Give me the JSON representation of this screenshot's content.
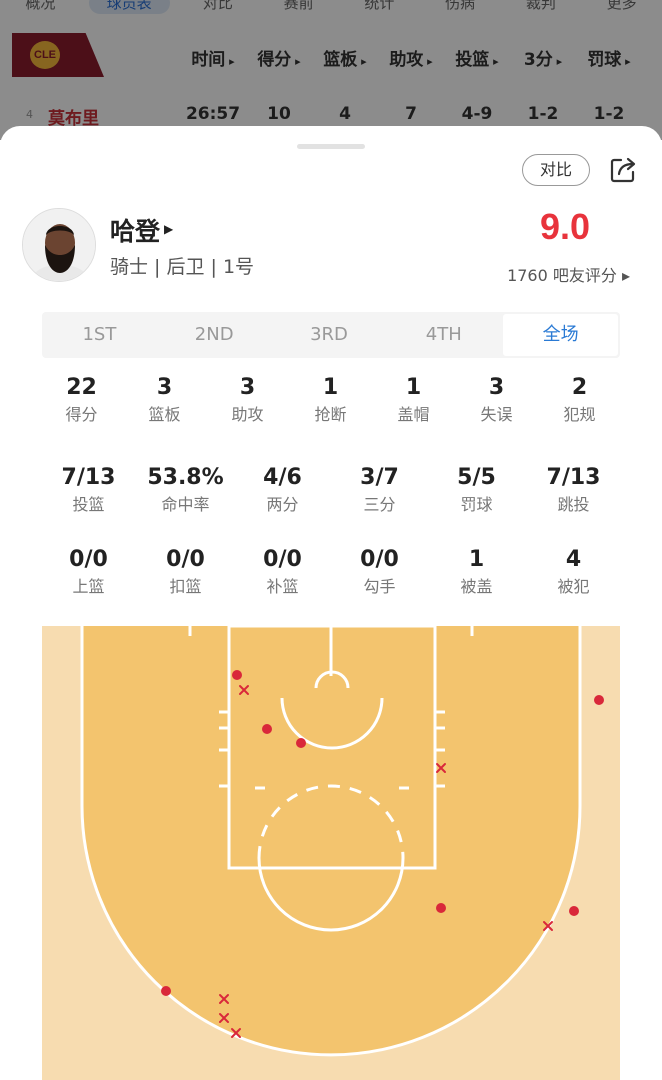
{
  "background": {
    "tabs": [
      "概况",
      "球员表",
      "对比",
      "赛前",
      "统计",
      "伤病",
      "裁判",
      "更多"
    ],
    "active_tab_index": 1,
    "team_logo_text": "CLE",
    "columns": [
      "时间",
      "得分",
      "篮板",
      "助攻",
      "投篮",
      "3分",
      "罚球"
    ],
    "row": {
      "rank": "4",
      "name": "莫布里",
      "values": [
        "26:57",
        "10",
        "4",
        "7",
        "4-9",
        "1-2",
        "1-2"
      ]
    }
  },
  "sheet": {
    "compare_label": "对比",
    "share_icon": "share-icon",
    "player": {
      "name": "哈登",
      "meta": "骑士 | 后卫 | 1号",
      "rating": "9.0",
      "rating_count": "1760 吧友评分 ▸"
    },
    "periods": [
      "1ST",
      "2ND",
      "3RD",
      "4TH",
      "全场"
    ],
    "active_period_index": 4,
    "stats_row1": [
      {
        "value": "22",
        "label": "得分"
      },
      {
        "value": "3",
        "label": "篮板"
      },
      {
        "value": "3",
        "label": "助攻"
      },
      {
        "value": "1",
        "label": "抢断"
      },
      {
        "value": "1",
        "label": "盖帽"
      },
      {
        "value": "3",
        "label": "失误"
      },
      {
        "value": "2",
        "label": "犯规"
      }
    ],
    "stats_row2": [
      {
        "value": "7/13",
        "label": "投篮"
      },
      {
        "value": "53.8%",
        "label": "命中率"
      },
      {
        "value": "4/6",
        "label": "两分"
      },
      {
        "value": "3/7",
        "label": "三分"
      },
      {
        "value": "5/5",
        "label": "罚球"
      },
      {
        "value": "7/13",
        "label": "跳投"
      }
    ],
    "stats_row3": [
      {
        "value": "0/0",
        "label": "上篮"
      },
      {
        "value": "0/0",
        "label": "扣篮"
      },
      {
        "value": "0/0",
        "label": "补篮"
      },
      {
        "value": "0/0",
        "label": "勾手"
      },
      {
        "value": "1",
        "label": "被盖"
      },
      {
        "value": "4",
        "label": "被犯"
      }
    ]
  },
  "colors": {
    "rating": "#e8333c",
    "active_tab": "#2a7ad4",
    "court_inside": "#f3c46e",
    "court_outside": "#f7dcb0",
    "make": "#d9283a",
    "miss": "#d9283a"
  },
  "shot_chart_legend": {
    "make": "dot",
    "miss": "cross"
  }
}
